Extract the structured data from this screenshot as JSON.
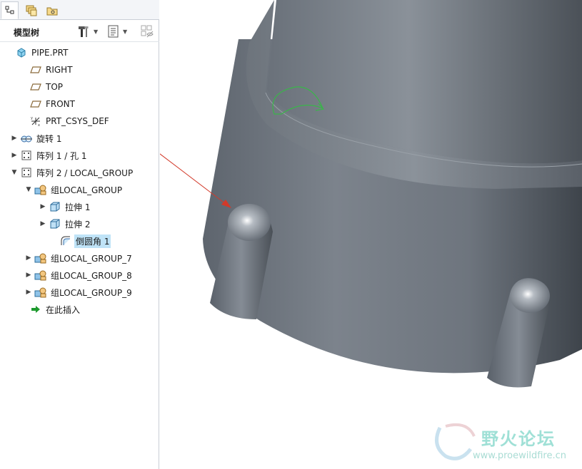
{
  "panel": {
    "title": "模型树",
    "tabs": [
      "model-tree-tab",
      "layers-tab",
      "folder-tab"
    ],
    "tools": [
      "hammer-settings-icon",
      "list-settings-icon",
      "show-filter-icon"
    ]
  },
  "tree": {
    "items": [
      {
        "label": "PIPE.PRT",
        "icon": "part-icon",
        "expand": ""
      },
      {
        "label": "RIGHT",
        "icon": "datum-plane-icon",
        "expand": ""
      },
      {
        "label": "TOP",
        "icon": "datum-plane-icon",
        "expand": ""
      },
      {
        "label": "FRONT",
        "icon": "datum-plane-icon",
        "expand": ""
      },
      {
        "label": "PRT_CSYS_DEF",
        "icon": "csys-icon",
        "expand": ""
      },
      {
        "label": "旋转 1",
        "icon": "revolve-icon",
        "expand": "▶"
      },
      {
        "label": "阵列 1 / 孔 1",
        "icon": "pattern-icon",
        "expand": "▶"
      },
      {
        "label": "阵列 2 / LOCAL_GROUP",
        "icon": "pattern-icon",
        "expand": "▼"
      },
      {
        "label": "组LOCAL_GROUP",
        "icon": "group-icon",
        "expand": "▼"
      },
      {
        "label": "拉伸 1",
        "icon": "extrude-icon",
        "expand": "▶"
      },
      {
        "label": "拉伸 2",
        "icon": "extrude-icon",
        "expand": "▶"
      },
      {
        "label": "倒圆角 1",
        "icon": "round-icon",
        "expand": ""
      },
      {
        "label": "组LOCAL_GROUP_7",
        "icon": "group-icon",
        "expand": "▶"
      },
      {
        "label": "组LOCAL_GROUP_8",
        "icon": "group-icon",
        "expand": "▶"
      },
      {
        "label": "组LOCAL_GROUP_9",
        "icon": "group-icon",
        "expand": "▶"
      },
      {
        "label": "在此插入",
        "icon": "insert-here-icon",
        "expand": ""
      }
    ],
    "selected": "倒圆角 1"
  },
  "watermark": {
    "text": "野火论坛",
    "url": "www.proewildfire.cn"
  },
  "colors": {
    "selection": "#bfe3f7",
    "model": "#6f7781",
    "annotation_arrow": "#d23a2a",
    "sketch": "#3ab54a"
  }
}
